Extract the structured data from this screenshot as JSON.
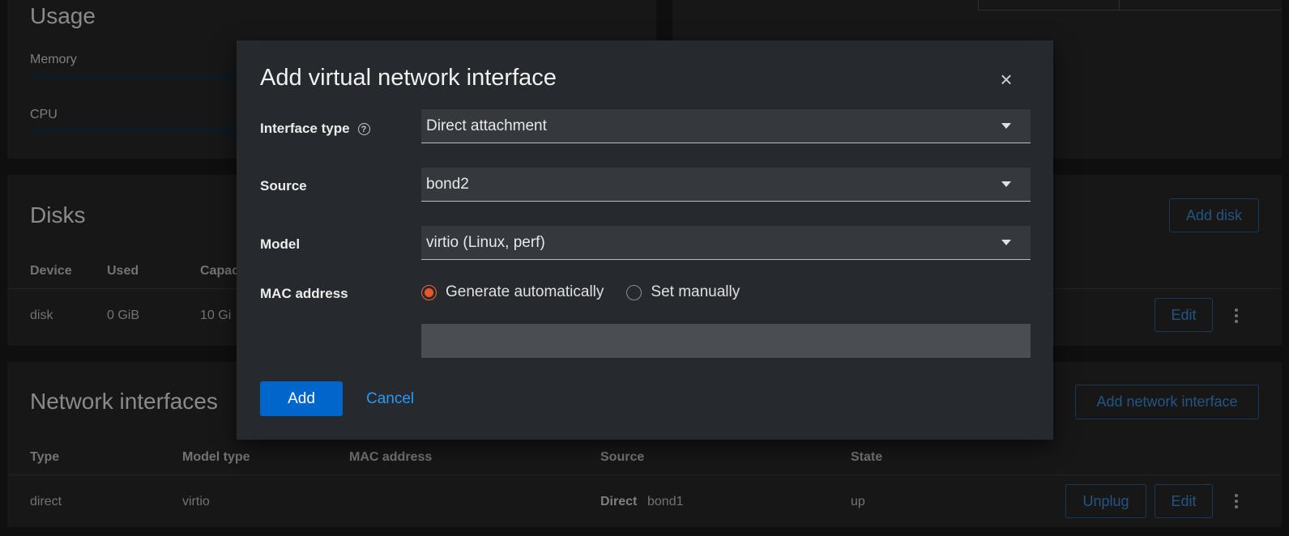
{
  "background": {
    "usage": {
      "title": "Usage",
      "memory_label": "Memory",
      "cpu_label": "CPU"
    },
    "disks": {
      "title": "Disks",
      "add_button": "Add disk",
      "columns": [
        "Device",
        "Used",
        "Capac"
      ],
      "row": {
        "device": "disk",
        "used": "0 GiB",
        "capacity": "10 Gi"
      },
      "edit_button": "Edit"
    },
    "network": {
      "title": "Network interfaces",
      "add_button": "Add network interface",
      "columns": [
        "Type",
        "Model type",
        "MAC address",
        "Source",
        "State"
      ],
      "row": {
        "type": "direct",
        "model": "virtio",
        "source_kind": "Direct",
        "source_name": "bond1",
        "state": "up"
      },
      "unplug_button": "Unplug",
      "edit_button": "Edit"
    }
  },
  "modal": {
    "title": "Add virtual network interface",
    "close_icon": "close-icon",
    "fields": {
      "interface_type": {
        "label": "Interface type",
        "value": "Direct attachment"
      },
      "source": {
        "label": "Source",
        "value": "bond2"
      },
      "model": {
        "label": "Model",
        "value": "virtio (Linux, perf)"
      },
      "mac": {
        "label": "MAC address",
        "options": [
          "Generate automatically",
          "Set manually"
        ],
        "selected": "Generate automatically",
        "value": ""
      }
    },
    "buttons": {
      "add": "Add",
      "cancel": "Cancel"
    }
  },
  "colors": {
    "primary": "#0066cc",
    "link": "#2b9af3",
    "radio_checked": "#e8562a",
    "modal_bg": "#26292d"
  }
}
